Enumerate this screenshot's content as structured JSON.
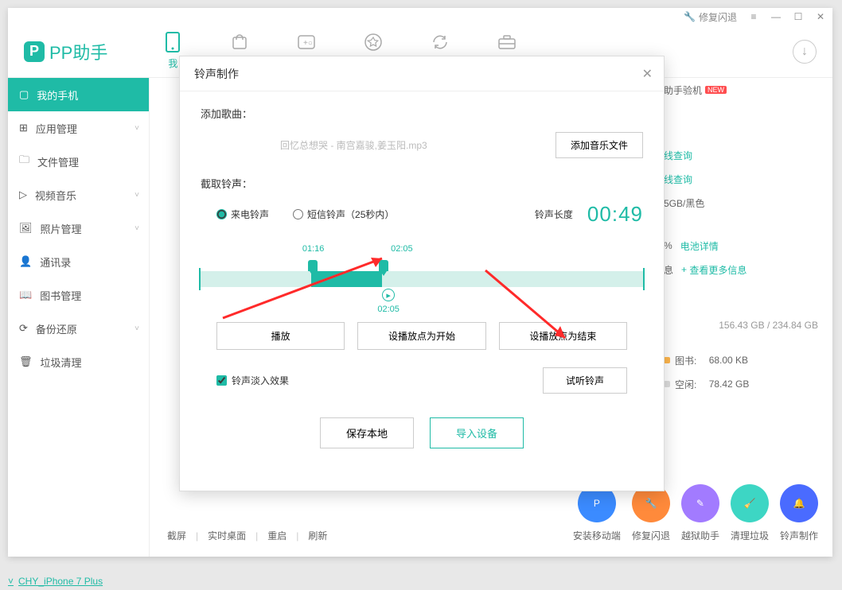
{
  "app": {
    "name": "PP助手",
    "fix_crash": "修复闪退"
  },
  "topnav": [
    "我",
    "",
    "",
    "",
    "",
    ""
  ],
  "sidebar": {
    "items": [
      {
        "label": "我的手机",
        "active": true,
        "chev": false
      },
      {
        "label": "应用管理",
        "chev": true
      },
      {
        "label": "文件管理",
        "chev": false
      },
      {
        "label": "视频音乐",
        "chev": true
      },
      {
        "label": "照片管理",
        "chev": true
      },
      {
        "label": "通讯录",
        "chev": false
      },
      {
        "label": "图书管理",
        "chev": false
      },
      {
        "label": "备份还原",
        "chev": true
      },
      {
        "label": "垃圾清理",
        "chev": false
      }
    ]
  },
  "right": {
    "verify": "助手验机",
    "query1": "线查询",
    "query2": "线查询",
    "model": "5GB/黑色",
    "pct": "%",
    "battery": "电池详情",
    "info": "息",
    "more": "查看更多信息",
    "freespace": "156.43 GB / 234.84 GB",
    "books_label": "图书:",
    "books": "68.00 KB",
    "free_label": "空闲:",
    "free": "78.42 GB"
  },
  "bottombar": {
    "cmds": [
      "截屏",
      "实时桌面",
      "重启",
      "刷新"
    ],
    "circles": [
      {
        "label": "安装移动端",
        "color": "#3b8bff"
      },
      {
        "label": "修复闪退",
        "color": "#ff8a3b"
      },
      {
        "label": "越狱助手",
        "color": "#a27bff"
      },
      {
        "label": "清理垃圾",
        "color": "#3dd6c4"
      },
      {
        "label": "铃声制作",
        "color": "#4a6bff"
      }
    ]
  },
  "status": "CHY_iPhone 7 Plus",
  "modal": {
    "title": "铃声制作",
    "add_label": "添加歌曲：",
    "song": "回忆总想哭 - 南宫嘉骏,姜玉阳.mp3",
    "add_btn": "添加音乐文件",
    "cut_label": "截取铃声：",
    "radio_call": "来电铃声",
    "radio_sms": "短信铃声（25秒内）",
    "dur_label": "铃声长度",
    "duration": "00:49",
    "t_start": "01:16",
    "t_end": "02:05",
    "t_play": "02:05",
    "btn_play": "播放",
    "btn_setstart": "设播放点为开始",
    "btn_setend": "设播放点为结束",
    "fade": "铃声淡入效果",
    "try": "试听铃声",
    "save": "保存本地",
    "import": "导入设备"
  }
}
